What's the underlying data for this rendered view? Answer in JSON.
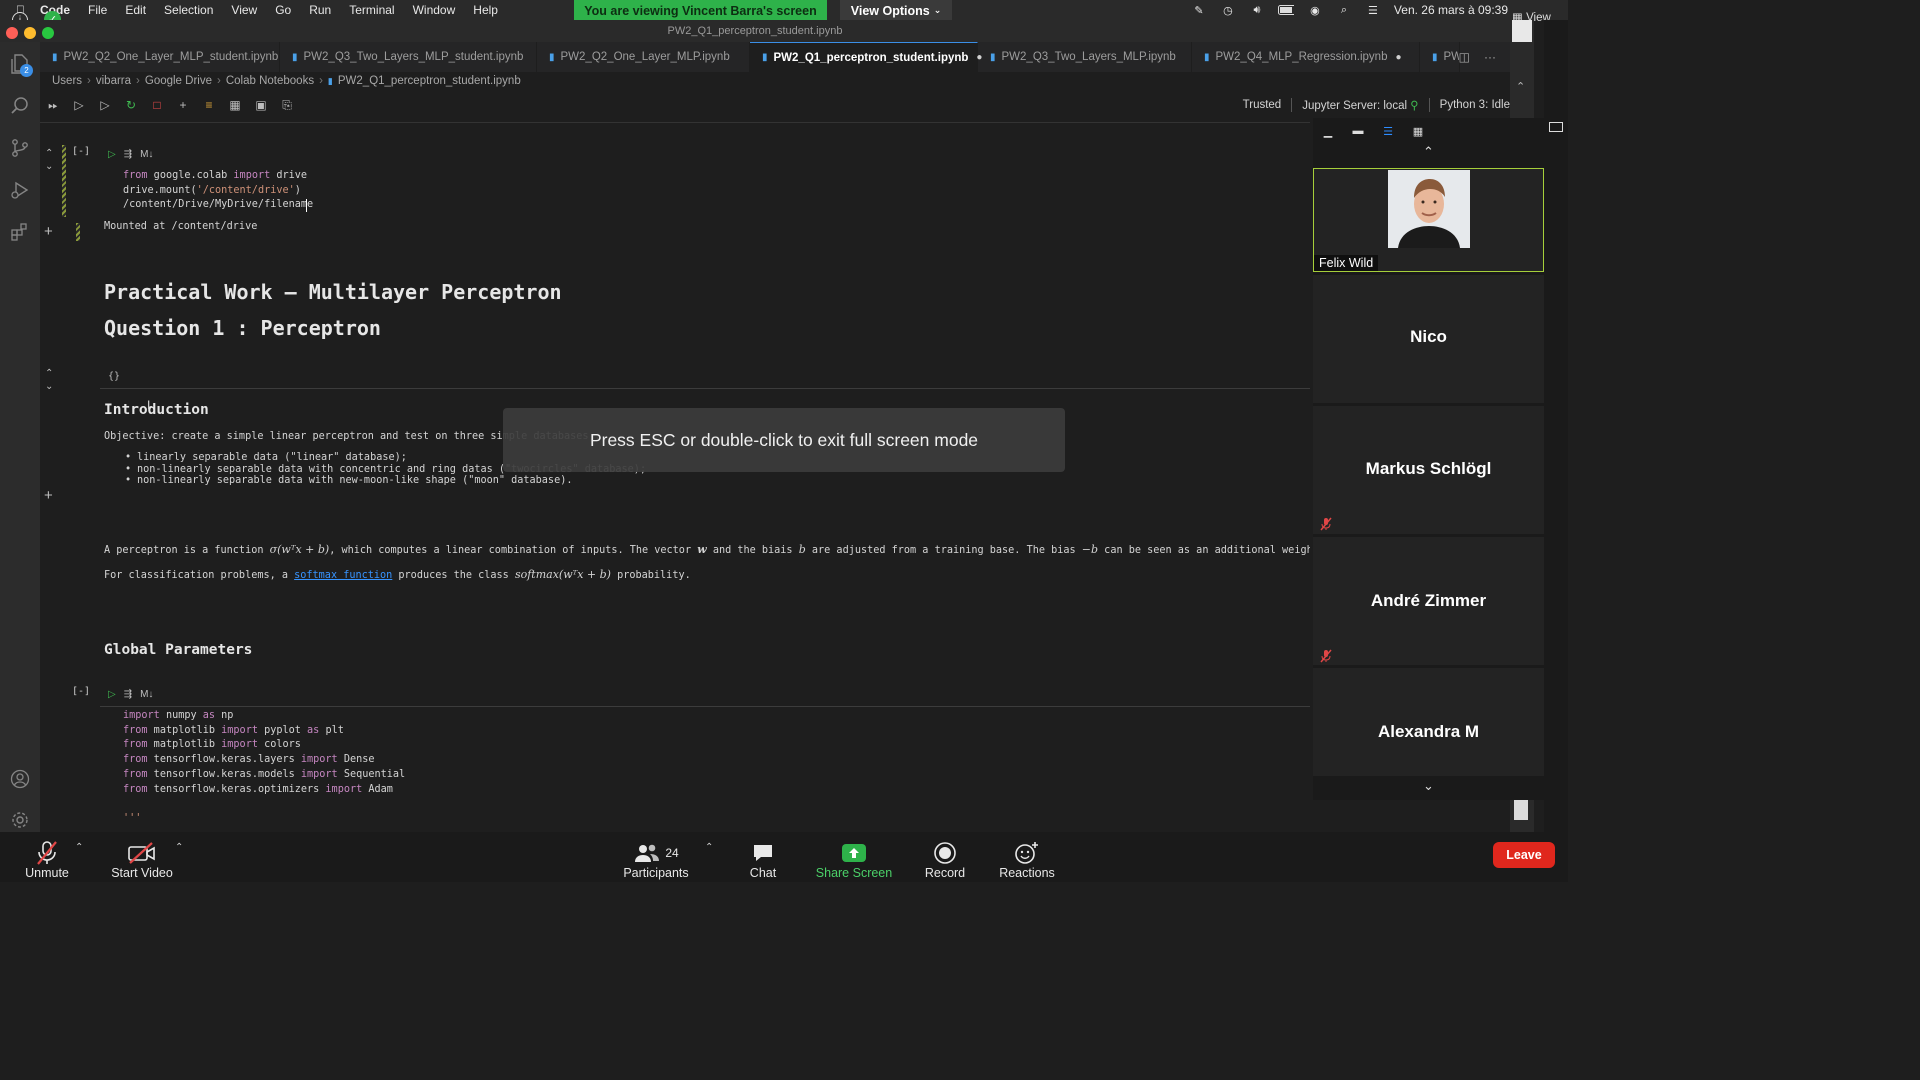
{
  "menubar": {
    "app": "Code",
    "items": [
      "File",
      "Edit",
      "Selection",
      "View",
      "Go",
      "Run",
      "Terminal",
      "Window",
      "Help"
    ],
    "viewing_banner": "You are viewing Vincent Barra's screen",
    "view_options": "View Options",
    "datetime": "Ven. 26 mars à 09:39",
    "view_label": "View"
  },
  "window_title": "PW2_Q1_perceptron_student.ipynb",
  "tabs": [
    {
      "label": "PW2_Q2_One_Layer_MLP_student.ipynb",
      "active": false,
      "modified": false
    },
    {
      "label": "PW2_Q3_Two_Layers_MLP_student.ipynb",
      "active": false,
      "modified": false
    },
    {
      "label": "PW2_Q2_One_Layer_MLP.ipynb",
      "active": false,
      "modified": false
    },
    {
      "label": "PW2_Q1_perceptron_student.ipynb",
      "active": true,
      "modified": true
    },
    {
      "label": "PW2_Q3_Two_Layers_MLP.ipynb",
      "active": false,
      "modified": false
    },
    {
      "label": "PW2_Q4_MLP_Regression.ipynb",
      "active": false,
      "modified": true
    },
    {
      "label": "PW",
      "active": false,
      "modified": false
    }
  ],
  "breadcrumb": [
    "Users",
    "vibarra",
    "Google Drive",
    "Colab Notebooks",
    "PW2_Q1_perceptron_student.ipynb"
  ],
  "kernel": {
    "trusted": "Trusted",
    "server": "Jupyter Server: local",
    "python": "Python 3: Idle"
  },
  "activity_badge": "2",
  "cells": {
    "cell1": {
      "exec_count": "[-]",
      "lang": "M↓",
      "lines": [
        [
          {
            "t": "from",
            "c": "kw"
          },
          {
            "t": " google.colab "
          },
          {
            "t": "import",
            "c": "kw"
          },
          {
            "t": " drive"
          }
        ],
        [
          {
            "t": "drive.mount("
          },
          {
            "t": "'/content/drive'",
            "c": "str"
          },
          {
            "t": ")"
          }
        ],
        [
          {
            "t": "/content/Drive/MyDrive/filename"
          }
        ]
      ],
      "output": "Mounted at /content/drive"
    },
    "title_h1": "Practical Work – Multilayer Perceptron",
    "question_h1": "Question 1 : Perceptron",
    "braces": "{}",
    "intro_h2": "Introduction",
    "objective": "Objective: create a simple linear perceptron and test on three simple databases :",
    "bullets": [
      "linearly separable data (\"linear\" database);",
      "non-linearly separable data with concentric and ring datas (\"twocircles\" database);",
      "non-linearly separable data with new-moon-like shape (\"moon\" database)."
    ],
    "perceptron_text_a": "A perceptron is a function ",
    "perceptron_math": "σ(wᵀx + b)",
    "perceptron_text_b": ", which computes a linear combination of inputs. The vector ",
    "perceptron_w": "w",
    "perceptron_text_c": " and the biais ",
    "perceptron_b": "b",
    "perceptron_text_d": " are adjusted from a training base. The bias ",
    "perceptron_negb": "−b",
    "perceptron_text_e": " can be seen as an additional weight, conn",
    "classif_a": "For classification problems, a ",
    "classif_link": "softmax function",
    "classif_b": " produces the class ",
    "classif_math": "softmax(wᵀx + b)",
    "classif_c": " probability.",
    "global_h2": "Global Parameters",
    "cell2": {
      "exec_count": "[-]",
      "lang": "M↓",
      "lines": [
        [
          {
            "t": "import",
            "c": "kw"
          },
          {
            "t": " numpy "
          },
          {
            "t": "as",
            "c": "kw"
          },
          {
            "t": " np"
          }
        ],
        [
          {
            "t": "from",
            "c": "kw"
          },
          {
            "t": " matplotlib "
          },
          {
            "t": "import",
            "c": "kw"
          },
          {
            "t": " pyplot "
          },
          {
            "t": "as",
            "c": "kw"
          },
          {
            "t": " plt"
          }
        ],
        [
          {
            "t": "from",
            "c": "kw"
          },
          {
            "t": " matplotlib "
          },
          {
            "t": "import",
            "c": "kw"
          },
          {
            "t": " colors"
          }
        ],
        [
          {
            "t": "from",
            "c": "kw"
          },
          {
            "t": " tensorflow.keras.layers "
          },
          {
            "t": "import",
            "c": "kw"
          },
          {
            "t": " Dense"
          }
        ],
        [
          {
            "t": "from",
            "c": "kw"
          },
          {
            "t": " tensorflow.keras.models "
          },
          {
            "t": "import",
            "c": "kw"
          },
          {
            "t": " Sequential"
          }
        ],
        [
          {
            "t": "from",
            "c": "kw"
          },
          {
            "t": " tensorflow.keras.optimizers "
          },
          {
            "t": "import",
            "c": "kw"
          },
          {
            "t": " Adam"
          }
        ],
        [
          {
            "t": ""
          }
        ],
        [
          {
            "t": "'''",
            "c": "str"
          }
        ]
      ]
    }
  },
  "fullscreen_notice": "Press ESC or double-click to exit full screen mode",
  "participants_panel": [
    {
      "name": "Felix Wild",
      "video": true,
      "muted": false
    },
    {
      "name": "Nico",
      "video": false,
      "muted": false
    },
    {
      "name": "Markus Schlögl",
      "video": false,
      "muted": true
    },
    {
      "name": "André Zimmer",
      "video": false,
      "muted": true
    },
    {
      "name": "Alexandra M",
      "video": false,
      "muted": false
    }
  ],
  "zoom_controls": {
    "unmute": "Unmute",
    "start_video": "Start Video",
    "participants": "Participants",
    "participant_count": "24",
    "chat": "Chat",
    "share_screen": "Share Screen",
    "record": "Record",
    "reactions": "Reactions",
    "leave": "Leave"
  },
  "colors": {
    "banner_green": "#2eb24a",
    "leave_red": "#e0271d",
    "tab_accent": "#3a8ee6",
    "keyword": "#c586c0",
    "string": "#ce9178",
    "link": "#3794ff"
  }
}
